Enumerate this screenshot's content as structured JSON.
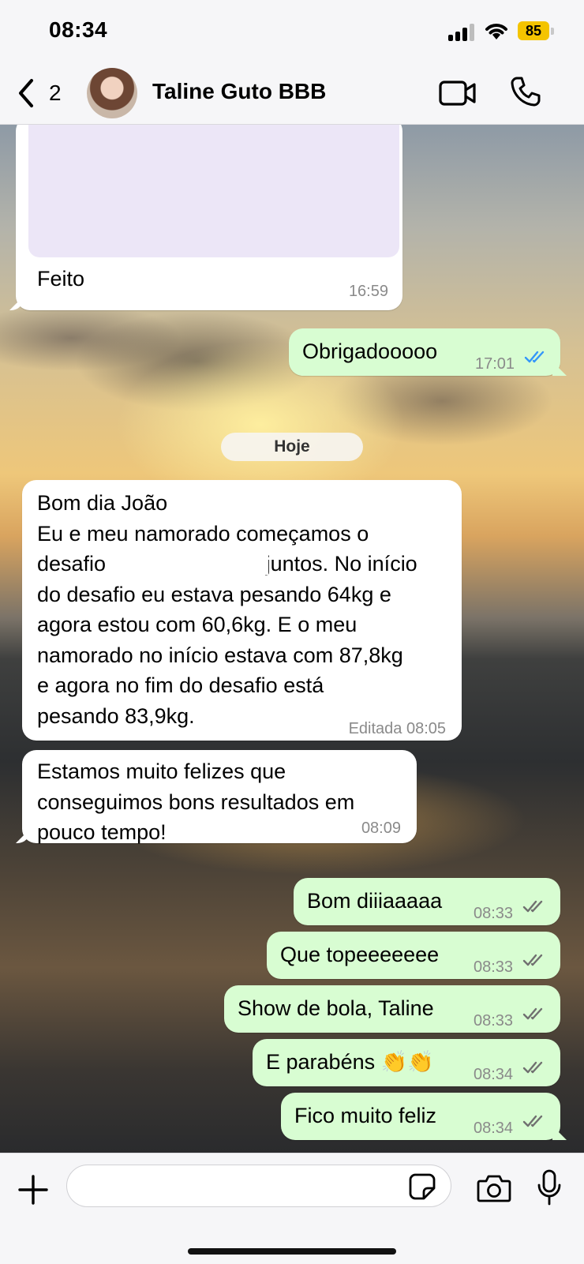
{
  "status_bar": {
    "time": "08:34",
    "battery": "85"
  },
  "header": {
    "back_count": "2",
    "contact_name": "Taline Guto BBB",
    "icons": {
      "back": "chevron-left-icon",
      "video": "video-camera-icon",
      "call": "phone-icon"
    }
  },
  "messages": [
    {
      "direction": "in",
      "text": "Feito",
      "time": "16:59",
      "has_media": true
    },
    {
      "direction": "out",
      "text": "Obrigadooooo",
      "time": "17:01",
      "status": "read"
    },
    {
      "type": "date",
      "text": "Hoje"
    },
    {
      "direction": "in",
      "text": "Bom dia João\nEu e meu namorado começamos o\ndesafio                           juntos. No início\ndo desafio eu estava pesando 64kg e\nagora estou com 60,6kg. E o meu\nnamorado no início estava com 87,8kg\ne agora no fim do desafio está\npesando 83,9kg.",
      "time": "Editada 08:05"
    },
    {
      "direction": "in",
      "text": "Estamos muito felizes que\nconseguimos bons resultados em\npouco tempo!",
      "time": "08:09"
    },
    {
      "direction": "out",
      "text": "Bom diiiaaaaa",
      "time": "08:33",
      "status": "delivered"
    },
    {
      "direction": "out",
      "text": "Que topeeeeeee",
      "time": "08:33",
      "status": "delivered"
    },
    {
      "direction": "out",
      "text": "Show de bola, Taline",
      "time": "08:33",
      "status": "delivered"
    },
    {
      "direction": "out",
      "text": "E parabéns 👏👏",
      "time": "08:34",
      "status": "delivered"
    },
    {
      "direction": "out",
      "text": "Fico muito feliz",
      "time": "08:34",
      "status": "delivered"
    }
  ],
  "input_bar": {
    "placeholder": "",
    "icons": {
      "add": "plus-icon",
      "sticker": "sticker-icon",
      "camera": "camera-icon",
      "mic": "microphone-icon"
    }
  },
  "colors": {
    "outgoing_bubble": "#d8fdd2",
    "incoming_bubble": "#ffffff",
    "read_ticks": "#3497f9",
    "battery": "#f4c400"
  }
}
